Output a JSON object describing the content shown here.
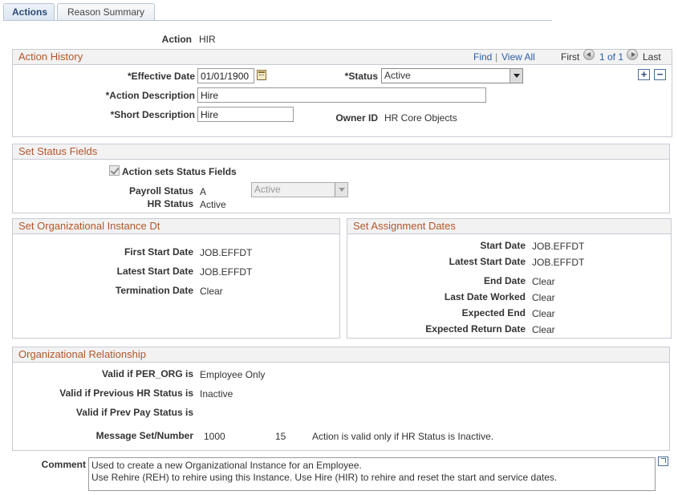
{
  "tabs": [
    {
      "label": "Actions",
      "active": true
    },
    {
      "label": "Reason Summary",
      "active": false
    }
  ],
  "action": {
    "label": "Action",
    "value": "HIR"
  },
  "action_history": {
    "title": "Action History",
    "find": "Find",
    "separator": "|",
    "view_all": "View All",
    "first": "First",
    "pager": "1 of 1",
    "last": "Last",
    "effective_date": {
      "label": "*Effective Date",
      "value": "01/01/1900"
    },
    "status": {
      "label": "*Status",
      "value": "Active"
    },
    "action_description": {
      "label": "*Action Description",
      "value": "Hire"
    },
    "short_description": {
      "label": "*Short Description",
      "value": "Hire"
    },
    "owner_id": {
      "label": "Owner ID",
      "value": "HR Core Objects"
    }
  },
  "status_fields": {
    "title": "Set Status Fields",
    "checkbox_label": "Action sets Status Fields",
    "checked": true,
    "payroll_status": {
      "label": "Payroll Status",
      "code": "A",
      "value": "Active"
    },
    "hr_status": {
      "label": "HR Status",
      "value": "Active"
    }
  },
  "org_instance": {
    "title": "Set Organizational Instance Dt",
    "first_start": {
      "label": "First Start Date",
      "value": "JOB.EFFDT"
    },
    "latest_start": {
      "label": "Latest Start Date",
      "value": "JOB.EFFDT"
    },
    "termination": {
      "label": "Termination Date",
      "value": "Clear"
    }
  },
  "assignment_dates": {
    "title": "Set Assignment Dates",
    "start_date": {
      "label": "Start Date",
      "value": "JOB.EFFDT"
    },
    "latest_start": {
      "label": "Latest Start Date",
      "value": "JOB.EFFDT"
    },
    "end_date": {
      "label": "End Date",
      "value": "Clear"
    },
    "last_worked": {
      "label": "Last Date Worked",
      "value": "Clear"
    },
    "expected_end": {
      "label": "Expected End",
      "value": "Clear"
    },
    "expected_return": {
      "label": "Expected Return Date",
      "value": "Clear"
    }
  },
  "org_relationship": {
    "title": "Organizational Relationship",
    "per_org": {
      "label": "Valid if PER_ORG is",
      "value": "Employee Only"
    },
    "prev_hr": {
      "label": "Valid if Previous HR Status is",
      "value": "Inactive"
    },
    "prev_pay": {
      "label": "Valid if Prev Pay Status is",
      "value": ""
    },
    "message": {
      "label": "Message Set/Number",
      "set": "1000",
      "number": "15",
      "text": "Action is valid only if HR Status is Inactive."
    }
  },
  "comment": {
    "label": "Comment",
    "line1": "Used to create a new Organizational Instance for an Employee.",
    "line2": "Use Rehire (REH) to rehire using this Instance.  Use Hire (HIR) to rehire and reset the start and service dates."
  }
}
